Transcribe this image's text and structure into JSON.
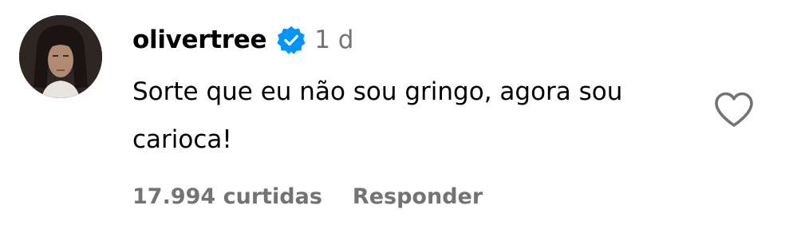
{
  "comment": {
    "username": "olivertree",
    "verified": true,
    "timestamp": "1 d",
    "text": "Sorte que eu não sou gringo, agora sou carioca!",
    "likes_label": "17.994 curtidas",
    "reply_label": "Responder"
  },
  "icons": {
    "verified": "verified-badge-icon",
    "like": "heart-outline-icon"
  },
  "colors": {
    "text_primary": "#000000",
    "text_secondary": "#737373",
    "verified_blue": "#0095f6",
    "heart_outline": "#737373"
  }
}
